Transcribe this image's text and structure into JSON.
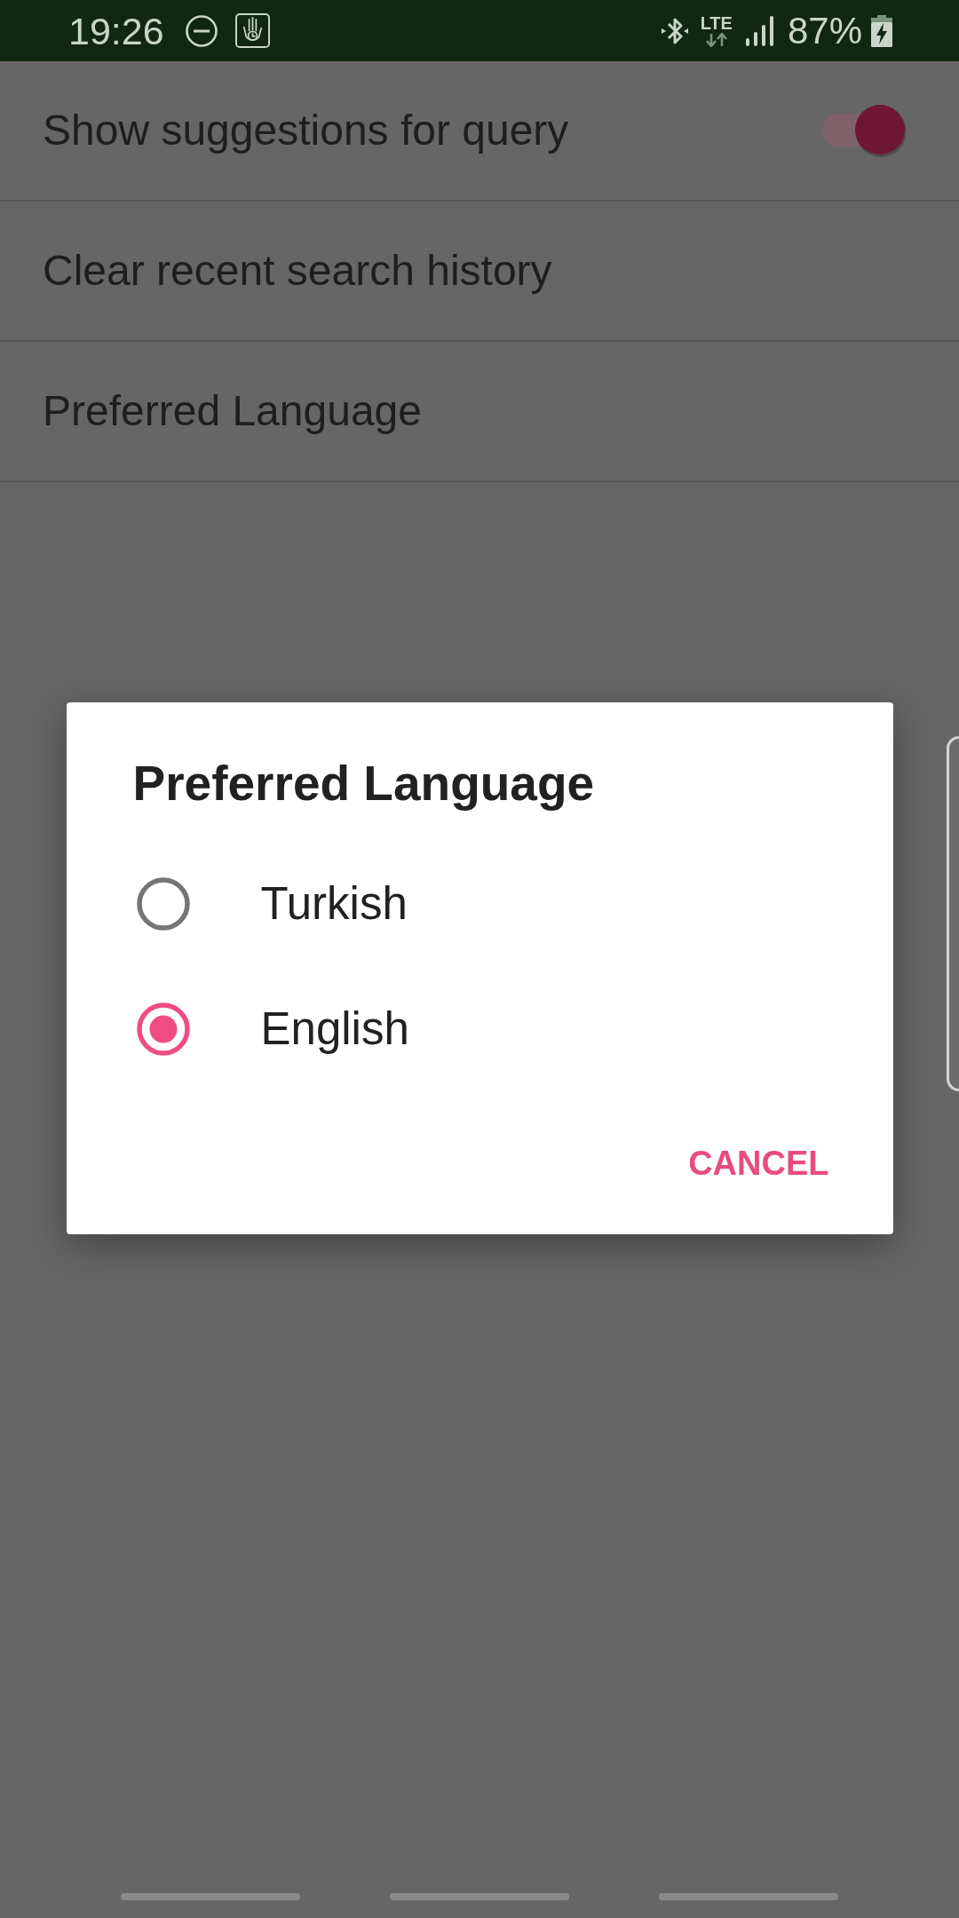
{
  "status_bar": {
    "time": "19:26",
    "network": "LTE",
    "battery": "87%"
  },
  "settings": [
    {
      "kind": "switch",
      "label": "Show suggestions for query",
      "on": true
    },
    {
      "kind": "action",
      "label": "Clear recent search history"
    },
    {
      "kind": "action",
      "label": "Preferred Language"
    }
  ],
  "dialog": {
    "title": "Preferred Language",
    "options": [
      {
        "label": "Turkish",
        "selected": false
      },
      {
        "label": "English",
        "selected": true
      }
    ],
    "buttons": [
      "CANCEL"
    ]
  }
}
